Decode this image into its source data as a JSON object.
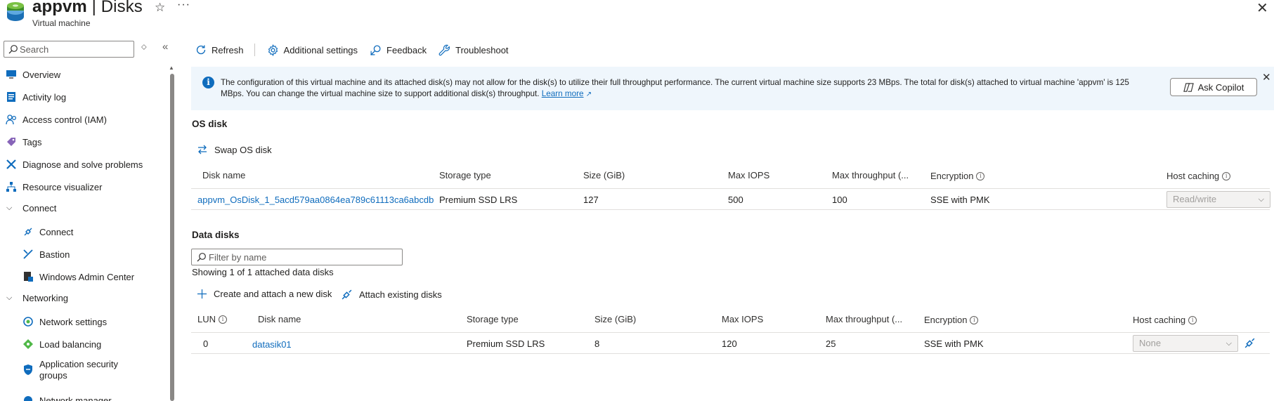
{
  "header": {
    "title_resource": "appvm",
    "title_separator": " | ",
    "title_page": "Disks",
    "subtitle": "Virtual machine"
  },
  "nav": {
    "search_placeholder": "Search",
    "items": {
      "overview": "Overview",
      "activity_log": "Activity log",
      "access_control": "Access control (IAM)",
      "tags": "Tags",
      "diagnose": "Diagnose and solve problems",
      "resource_visualizer": "Resource visualizer",
      "connect_group": "Connect",
      "connect": "Connect",
      "bastion": "Bastion",
      "windows_admin_center": "Windows Admin Center",
      "networking_group": "Networking",
      "network_settings": "Network settings",
      "load_balancing": "Load balancing",
      "app_security_groups_line1": "Application security",
      "app_security_groups_line2": "groups",
      "network_manager": "Network manager"
    }
  },
  "toolbar": {
    "refresh": "Refresh",
    "additional_settings": "Additional settings",
    "feedback": "Feedback",
    "troubleshoot": "Troubleshoot"
  },
  "banner": {
    "line1": "The configuration of this virtual machine and its attached disk(s) may not allow for the disk(s) to utilize their full throughput performance. The current virtual machine size supports 23 MBps. The total for disk(s) attached to virtual machine 'appvm' is 125",
    "line2": "MBps. You can change the virtual machine size to support additional disk(s) throughput.",
    "learn_more": "Learn more",
    "ask_copilot": "Ask Copilot"
  },
  "os_disk": {
    "title": "OS disk",
    "swap_label": "Swap OS disk",
    "columns": {
      "name": "Disk name",
      "storage": "Storage type",
      "size": "Size (GiB)",
      "iops": "Max IOPS",
      "throughput": "Max throughput (...",
      "encryption": "Encryption",
      "caching": "Host caching"
    },
    "row": {
      "name": "appvm_OsDisk_1_5acd579aa0864ea789c61113ca6abcdb",
      "storage": "Premium SSD LRS",
      "size": "127",
      "iops": "500",
      "throughput": "100",
      "encryption": "SSE with PMK",
      "caching": "Read/write"
    }
  },
  "data_disks": {
    "title": "Data disks",
    "filter_placeholder": "Filter by name",
    "showing": "Showing 1 of 1 attached data disks",
    "create_label": "Create and attach a new disk",
    "attach_label": "Attach existing disks",
    "columns": {
      "lun": "LUN",
      "name": "Disk name",
      "storage": "Storage type",
      "size": "Size (GiB)",
      "iops": "Max IOPS",
      "throughput": "Max throughput (...",
      "encryption": "Encryption",
      "caching": "Host caching"
    },
    "row": {
      "lun": "0",
      "name": "datasik01",
      "storage": "Premium SSD LRS",
      "size": "8",
      "iops": "120",
      "throughput": "25",
      "encryption": "SSE with PMK",
      "caching": "None"
    }
  },
  "colors": {
    "link": "#0f6cbd",
    "banner_bg": "#eff6fc",
    "info_icon": "#0f6cbd"
  },
  "icons": [
    "vm-disk-icon",
    "star-icon",
    "more-icon",
    "close-icon",
    "search-icon",
    "refresh-icon",
    "gear-icon",
    "feedback-icon",
    "wrench-icon",
    "info-icon",
    "copilot-icon",
    "swap-icon",
    "plus-icon",
    "attach-icon",
    "chevron-down-icon",
    "detach-icon"
  ]
}
